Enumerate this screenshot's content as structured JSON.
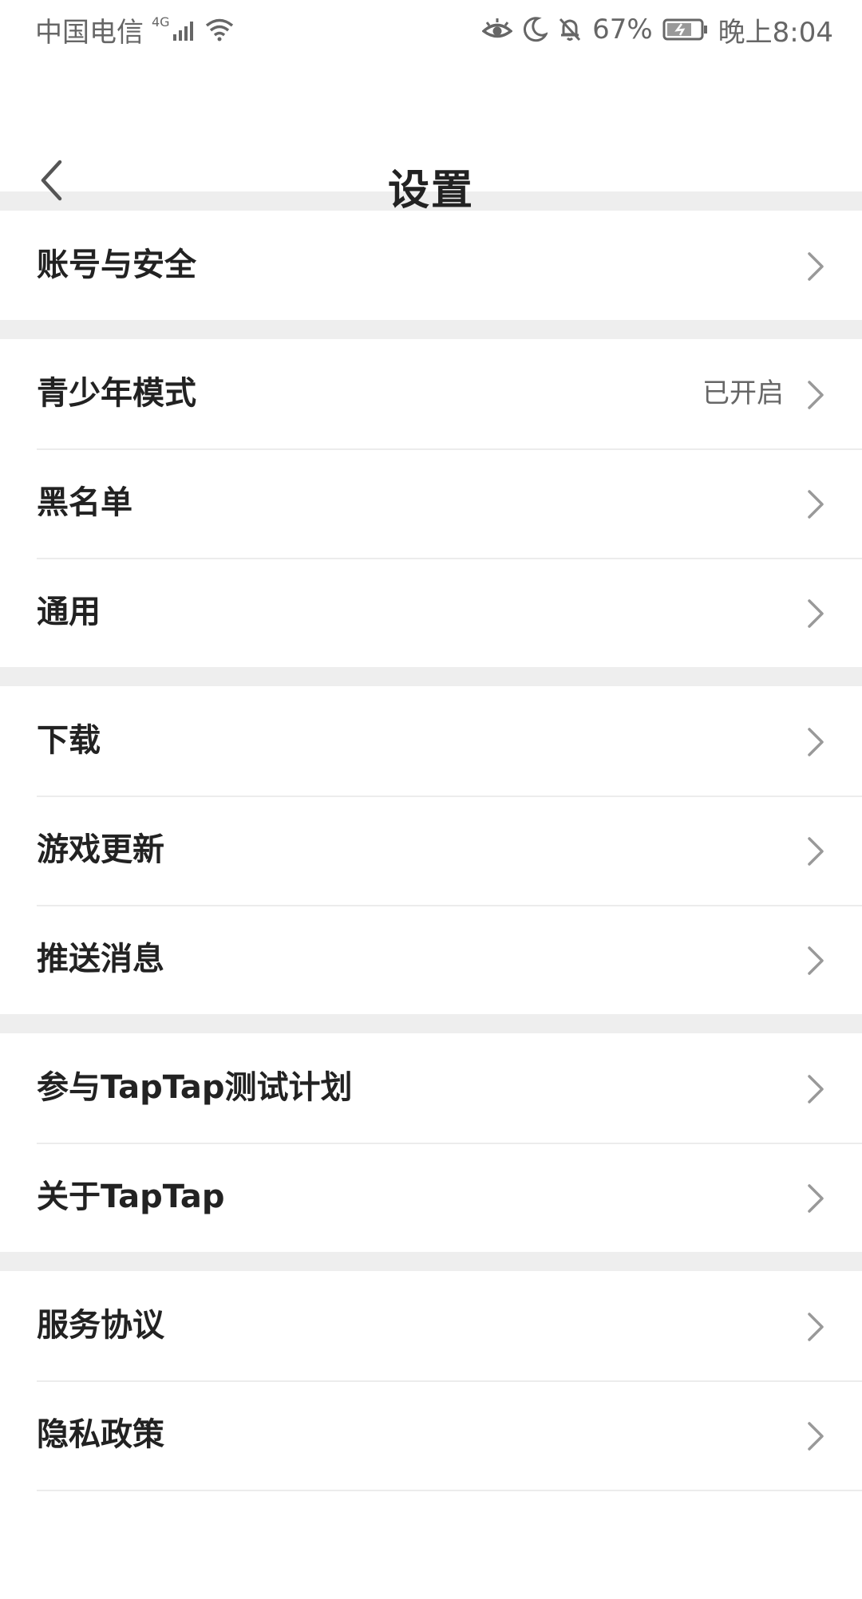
{
  "status_bar": {
    "carrier": "中国电信",
    "network_type": "4G",
    "battery_percent": "67%",
    "time": "晚上8:04",
    "icons": [
      "signal-icon",
      "wifi-icon",
      "eye-comfort-icon",
      "moon-icon",
      "bell-off-icon",
      "battery-icon"
    ]
  },
  "header": {
    "title": "设置",
    "back_icon": "chevron-left-icon"
  },
  "groups": [
    {
      "items": [
        {
          "label": "账号与安全"
        }
      ]
    },
    {
      "items": [
        {
          "label": "青少年模式",
          "value": "已开启"
        },
        {
          "label": "黑名单"
        },
        {
          "label": "通用"
        }
      ]
    },
    {
      "items": [
        {
          "label": "下载"
        },
        {
          "label": "游戏更新"
        },
        {
          "label": "推送消息"
        }
      ]
    },
    {
      "items": [
        {
          "label": "参与TapTap测试计划"
        },
        {
          "label": "关于TapTap"
        }
      ]
    },
    {
      "items": [
        {
          "label": "服务协议"
        },
        {
          "label": "隐私政策"
        }
      ]
    }
  ],
  "colors": {
    "background": "#ffffff",
    "divider_band": "#eeeeee",
    "text_primary": "#222222",
    "text_secondary": "#666666",
    "chevron": "#999999"
  }
}
